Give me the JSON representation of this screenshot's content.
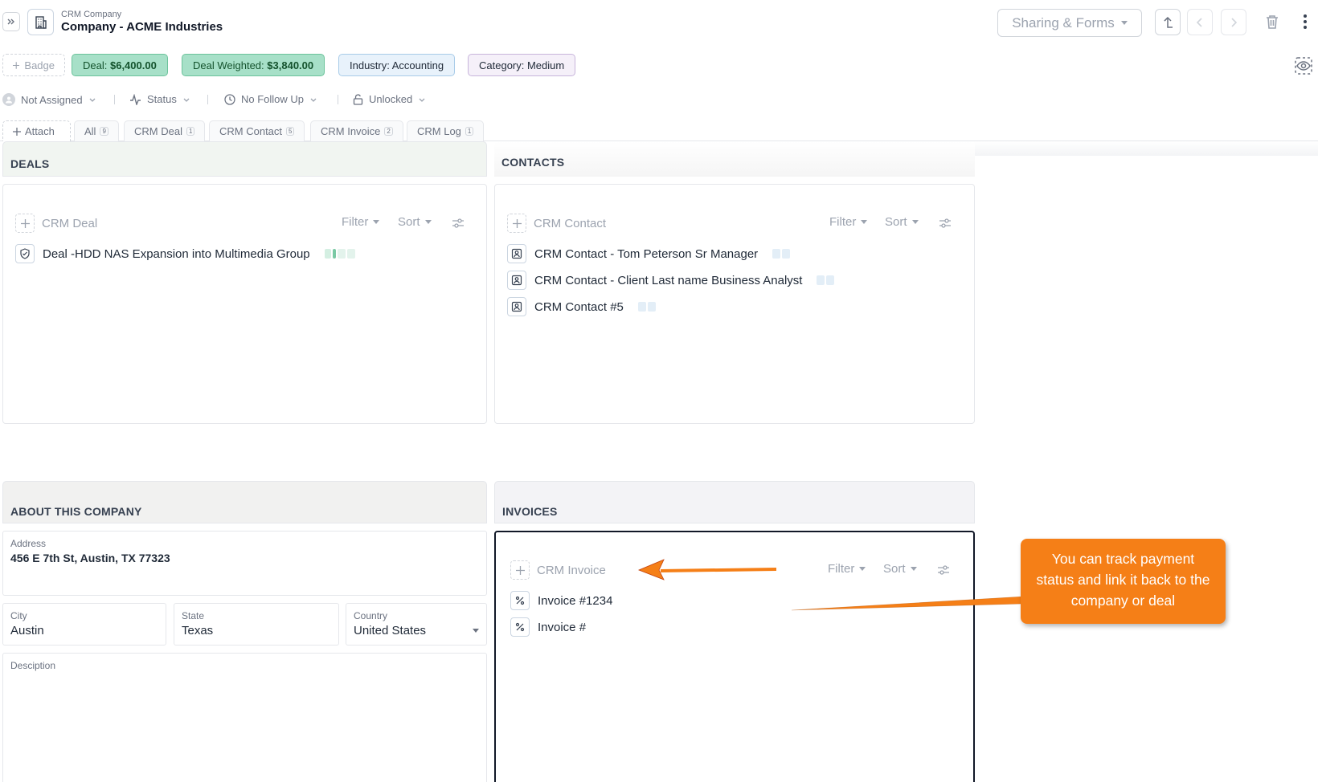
{
  "header": {
    "breadcrumb": "CRM Company",
    "title": "Company - ACME Industries",
    "sharing_label": "Sharing & Forms"
  },
  "badges": {
    "add_label": "Badge",
    "deal_key": "Deal:",
    "deal_value": "$6,400.00",
    "weighted_key": "Deal Weighted:",
    "weighted_value": "$3,840.00",
    "industry": "Industry: Accounting",
    "category": "Category: Medium"
  },
  "status_row": {
    "assignee": "Not Assigned",
    "status": "Status",
    "follow_up": "No Follow Up",
    "lock": "Unlocked"
  },
  "tabs": [
    {
      "label": "Attach"
    },
    {
      "label": "All",
      "count": "9"
    },
    {
      "label": "CRM Deal",
      "count": "1"
    },
    {
      "label": "CRM Contact",
      "count": "5"
    },
    {
      "label": "CRM Invoice",
      "count": "2"
    },
    {
      "label": "CRM Log",
      "count": "1"
    }
  ],
  "deals": {
    "heading": "DEALS",
    "type_label": "CRM Deal",
    "filter_label": "Filter",
    "sort_label": "Sort",
    "items": [
      "Deal -HDD NAS Expansion into Multimedia Group"
    ]
  },
  "contacts": {
    "heading": "CONTACTS",
    "type_label": "CRM Contact",
    "filter_label": "Filter",
    "sort_label": "Sort",
    "items": [
      "CRM Contact - Tom Peterson Sr Manager",
      "CRM Contact - Client Last name Business Analyst",
      "CRM Contact #5"
    ]
  },
  "about": {
    "heading": "ABOUT THIS COMPANY",
    "address_label": "Address",
    "address_value": "456 E 7th St, Austin, TX 77323",
    "city_label": "City",
    "city_value": "Austin",
    "state_label": "State",
    "state_value": "Texas",
    "country_label": "Country",
    "country_value": "United States",
    "description_label": "Desciption"
  },
  "invoices": {
    "heading": "INVOICES",
    "type_label": "CRM Invoice",
    "filter_label": "Filter",
    "sort_label": "Sort",
    "items": [
      "Invoice #1234",
      "Invoice #"
    ]
  },
  "callout": {
    "text": "You can track payment status and link it back to the company or deal",
    "color": "#f57f17"
  },
  "colors": {
    "deal_badge_bg": "#a7e0c8",
    "industry_badge_bg": "#e8f2fb",
    "category_badge_bg": "#f5f0f9"
  }
}
